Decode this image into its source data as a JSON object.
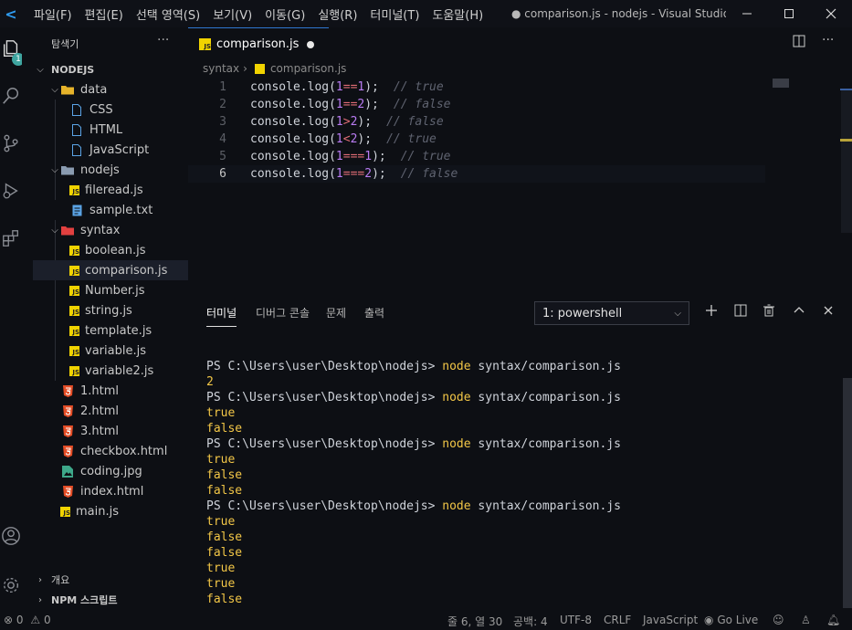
{
  "menu": [
    "파일(F)",
    "편집(E)",
    "선택 영역(S)",
    "보기(V)",
    "이동(G)",
    "실행(R)",
    "터미널(T)",
    "도움말(H)"
  ],
  "window_title": "● comparison.js - nodejs - Visual Studio C...",
  "activity": {
    "scm_badge": "1"
  },
  "sidebar": {
    "title": "탐색기",
    "more": "···",
    "root": "NODEJS",
    "tree": [
      {
        "label": "data",
        "type": "folder"
      },
      {
        "label": "CSS",
        "type": "file"
      },
      {
        "label": "HTML",
        "type": "file"
      },
      {
        "label": "JavaScript",
        "type": "file"
      },
      {
        "label": "nodejs",
        "type": "folder"
      },
      {
        "label": "fileread.js",
        "type": "js"
      },
      {
        "label": "sample.txt",
        "type": "txt"
      },
      {
        "label": "syntax",
        "type": "folder"
      },
      {
        "label": "boolean.js",
        "type": "js"
      },
      {
        "label": "comparison.js",
        "type": "js"
      },
      {
        "label": "Number.js",
        "type": "js"
      },
      {
        "label": "string.js",
        "type": "js"
      },
      {
        "label": "template.js",
        "type": "js"
      },
      {
        "label": "variable.js",
        "type": "js"
      },
      {
        "label": "variable2.js",
        "type": "js"
      },
      {
        "label": "1.html",
        "type": "html"
      },
      {
        "label": "2.html",
        "type": "html"
      },
      {
        "label": "3.html",
        "type": "html"
      },
      {
        "label": "checkbox.html",
        "type": "html"
      },
      {
        "label": "coding.jpg",
        "type": "jpg"
      },
      {
        "label": "index.html",
        "type": "html"
      },
      {
        "label": "main.js",
        "type": "js"
      }
    ],
    "outline": "개요",
    "npm": "NPM 스크립트"
  },
  "editor": {
    "tab": "comparison.js",
    "breadcrumb": [
      "syntax",
      "comparison.js"
    ],
    "lines": [
      {
        "n": "1",
        "fn": "console.log(",
        "a": "1",
        "op": "==",
        "b": "1",
        "end": ");",
        "cm": "// true"
      },
      {
        "n": "2",
        "fn": "console.log(",
        "a": "1",
        "op": "==",
        "b": "2",
        "end": ");",
        "cm": "// false"
      },
      {
        "n": "3",
        "fn": "console.log(",
        "a": "1",
        "op": ">",
        "b": "2",
        "end": ");",
        "cm": "// false"
      },
      {
        "n": "4",
        "fn": "console.log(",
        "a": "1",
        "op": "<",
        "b": "2",
        "end": ");",
        "cm": "// true"
      },
      {
        "n": "5",
        "fn": "console.log(",
        "a": "1",
        "op": "===",
        "b": "1",
        "end": ");",
        "cm": "// true"
      },
      {
        "n": "6",
        "fn": "console.log(",
        "a": "1",
        "op": "===",
        "b": "2",
        "end": ");",
        "cm": "// false"
      }
    ]
  },
  "panel": {
    "tabs": [
      "터미널",
      "디버그 콘솔",
      "문제",
      "출력"
    ],
    "terminal_select": "1: powershell",
    "prompt": "PS C:\\Users\\user\\Desktop\\nodejs>",
    "command_word": "node",
    "command_arg": " syntax/comparison.js",
    "output": [
      {
        "kind": "cmd"
      },
      {
        "kind": "out",
        "text": "2"
      },
      {
        "kind": "cmd"
      },
      {
        "kind": "out",
        "text": "true"
      },
      {
        "kind": "out",
        "text": "false"
      },
      {
        "kind": "cmd"
      },
      {
        "kind": "out",
        "text": "true"
      },
      {
        "kind": "out",
        "text": "false"
      },
      {
        "kind": "out",
        "text": "false"
      },
      {
        "kind": "cmd"
      },
      {
        "kind": "out",
        "text": "true"
      },
      {
        "kind": "out",
        "text": "false"
      },
      {
        "kind": "out",
        "text": "false"
      },
      {
        "kind": "out",
        "text": "true"
      },
      {
        "kind": "out",
        "text": "true"
      },
      {
        "kind": "out",
        "text": "false"
      }
    ]
  },
  "status": {
    "errors": "0",
    "warnings": "0",
    "position": "줄 6, 열 30",
    "spaces": "공백: 4",
    "encoding": "UTF-8",
    "eol": "CRLF",
    "language": "JavaScript",
    "golive": "Go Live"
  },
  "colors": {
    "accent": "#2f77d0",
    "terminal_yellow": "#f3c747",
    "js_icon": "#f1d300",
    "html_icon": "#e44d26"
  }
}
